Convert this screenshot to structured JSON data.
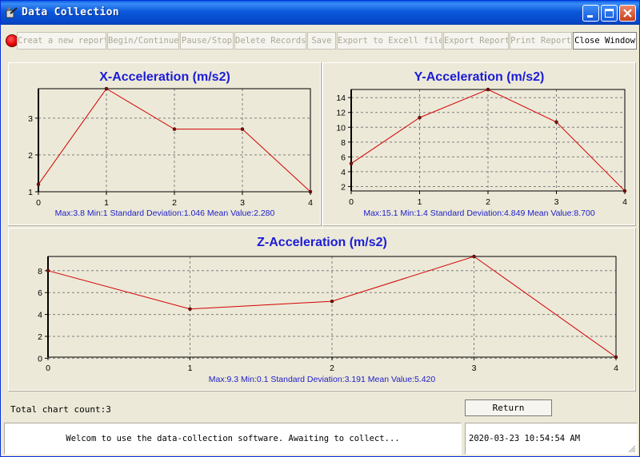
{
  "window": {
    "title": "Data Collection"
  },
  "toolbar": {
    "buttons": [
      {
        "label": "Creat a new report",
        "enabled": false
      },
      {
        "label": "Begin/Continue",
        "enabled": false
      },
      {
        "label": "Pause/Stop",
        "enabled": false
      },
      {
        "label": "Delete Records",
        "enabled": false
      },
      {
        "label": "Save",
        "enabled": false
      },
      {
        "label": "Export to Excell file",
        "enabled": false
      },
      {
        "label": "Export Report",
        "enabled": false
      },
      {
        "label": "Print Report",
        "enabled": false
      },
      {
        "label": "Close Window",
        "enabled": true
      }
    ]
  },
  "chart_data": [
    {
      "type": "line",
      "title": "X-Acceleration (m/s2)",
      "x": [
        0,
        1,
        2,
        3,
        4
      ],
      "values": [
        1.2,
        3.8,
        2.7,
        2.7,
        1.0
      ],
      "xticks": [
        "0",
        "1",
        "2",
        "3",
        "4"
      ],
      "yticks": [
        "1",
        "2",
        "3"
      ],
      "ylim": [
        1,
        3.8
      ],
      "grid": true,
      "color": "#d40000",
      "stats": "Max:3.8  Min:1 Standard Deviation:1.046 Mean Value:2.280"
    },
    {
      "type": "line",
      "title": "Y-Acceleration (m/s2)",
      "x": [
        0,
        1,
        2,
        3,
        4
      ],
      "values": [
        5.1,
        11.3,
        15.1,
        10.7,
        1.4
      ],
      "xticks": [
        "0",
        "1",
        "2",
        "3",
        "4"
      ],
      "yticks": [
        "2",
        "4",
        "6",
        "8",
        "10",
        "12",
        "14"
      ],
      "ylim": [
        1.4,
        15.1
      ],
      "grid": true,
      "color": "#d40000",
      "stats": "Max:15.1  Min:1.4 Standard Deviation:4.849 Mean Value:8.700"
    },
    {
      "type": "line",
      "title": "Z-Acceleration (m/s2)",
      "x": [
        0,
        1,
        2,
        3,
        4
      ],
      "values": [
        8.0,
        4.5,
        5.2,
        9.3,
        0.1
      ],
      "xticks": [
        "0",
        "1",
        "2",
        "3",
        "4"
      ],
      "yticks": [
        "0",
        "2",
        "4",
        "6",
        "8"
      ],
      "ylim": [
        0.1,
        9.3
      ],
      "grid": true,
      "color": "#d40000",
      "stats": "Max:9.3  Min:0.1 Standard Deviation:3.191 Mean Value:5.420"
    }
  ],
  "footer": {
    "count_text": "Total chart count:3",
    "return_label": "Return"
  },
  "statusbar": {
    "message": "Welcom to use the data-collection software. Awaiting to collect...",
    "timestamp": "2020-03-23 10:54:54 AM"
  }
}
